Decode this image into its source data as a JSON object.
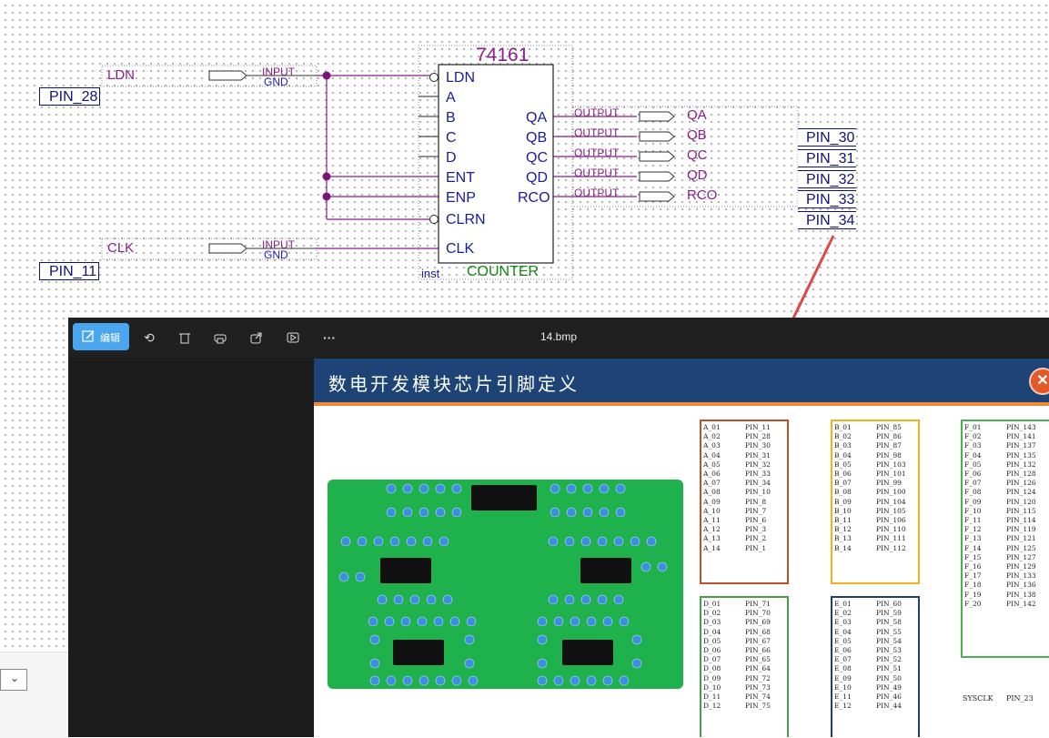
{
  "schematic": {
    "chip_name": "74161",
    "chip_type": "COUNTER",
    "inst_label": "inst",
    "inputs": [
      {
        "name": "LDN",
        "kind": "INPUT",
        "sub": "GND",
        "pin": "PIN_28"
      },
      {
        "name": "CLK",
        "kind": "INPUT",
        "sub": "GND",
        "pin": "PIN_11"
      }
    ],
    "chip_left_pins": [
      "LDN",
      "A",
      "B",
      "C",
      "D",
      "ENT",
      "ENP",
      "CLRN",
      "CLK"
    ],
    "chip_right_pins": [
      "QA",
      "QB",
      "QC",
      "QD",
      "RCO"
    ],
    "outputs": [
      {
        "kind": "OUTPUT",
        "name": "QA",
        "pin": "PIN_30"
      },
      {
        "kind": "OUTPUT",
        "name": "QB",
        "pin": "PIN_31"
      },
      {
        "kind": "OUTPUT",
        "name": "QC",
        "pin": "PIN_32"
      },
      {
        "kind": "OUTPUT",
        "name": "QD",
        "pin": "PIN_33"
      },
      {
        "kind": "OUTPUT",
        "name": "RCO",
        "pin": "PIN_34"
      }
    ],
    "arrow_color": "#e04848"
  },
  "viewer": {
    "edit_label": "编辑",
    "file_name": "14.bmp",
    "more_icon": "ellipsis-icon",
    "image": {
      "title": "数电开发模块芯片引脚定义",
      "board_color": "#1fb24c",
      "sysclk": {
        "name": "SYSCLK",
        "pin": "PIN_23"
      },
      "groups": [
        {
          "id": "A",
          "color": "#c0502a",
          "names": [
            "A_01",
            "A_02",
            "A_03",
            "A_04",
            "A_05",
            "A_06",
            "A_07",
            "A_08",
            "A_09",
            "A_10",
            "A_11",
            "A_12",
            "A_13",
            "A_14"
          ],
          "pins": [
            "PIN_11",
            "PIN_28",
            "PIN_30",
            "PIN_31",
            "PIN_32",
            "PIN_33",
            "PIN_34",
            "PIN_10",
            "PIN_8",
            "PIN_7",
            "PIN_6",
            "PIN_3",
            "PIN_2",
            "PIN_1"
          ]
        },
        {
          "id": "B",
          "color": "#f2b21e",
          "names": [
            "B_01",
            "B_02",
            "B_03",
            "B_04",
            "B_05",
            "B_06",
            "B_07",
            "B_08",
            "B_09",
            "B_10",
            "B_11",
            "B_12",
            "B_13",
            "B_14"
          ],
          "pins": [
            "PIN_85",
            "PIN_86",
            "PIN_87",
            "PIN_98",
            "PIN_103",
            "PIN_101",
            "PIN_99",
            "PIN_100",
            "PIN_104",
            "PIN_105",
            "PIN_106",
            "PIN_110",
            "PIN_111",
            "PIN_112"
          ]
        },
        {
          "id": "F",
          "color": "#4caf50",
          "names": [
            "F_01",
            "F_02",
            "F_03",
            "F_04",
            "F_05",
            "F_06",
            "F_07",
            "F_08",
            "F_09",
            "F_10",
            "F_11",
            "F_12",
            "F_13",
            "F_14",
            "F_15",
            "F_16",
            "F_17",
            "F_18",
            "F_19",
            "F_20"
          ],
          "pins": [
            "PIN_143",
            "PIN_141",
            "PIN_137",
            "PIN_135",
            "PIN_132",
            "PIN_128",
            "PIN_126",
            "PIN_124",
            "PIN_120",
            "PIN_115",
            "PIN_114",
            "PIN_119",
            "PIN_121",
            "PIN_125",
            "PIN_127",
            "PIN_129",
            "PIN_133",
            "PIN_136",
            "PIN_138",
            "PIN_142"
          ]
        },
        {
          "id": "D",
          "color": "#43a047",
          "names": [
            "D_01",
            "D_02",
            "D_03",
            "D_04",
            "D_05",
            "D_06",
            "D_07",
            "D_08",
            "D_09",
            "D_10",
            "D_11",
            "D_12"
          ],
          "pins": [
            "PIN_71",
            "PIN_70",
            "PIN_69",
            "PIN_68",
            "PIN_67",
            "PIN_66",
            "PIN_65",
            "PIN_64",
            "PIN_72",
            "PIN_73",
            "PIN_74",
            "PIN_75"
          ]
        },
        {
          "id": "E",
          "color": "#1d3f73",
          "names": [
            "E_01",
            "E_02",
            "E_03",
            "E_04",
            "E_05",
            "E_06",
            "E_07",
            "E_08",
            "E_09",
            "E_10",
            "E_11",
            "E_12"
          ],
          "pins": [
            "PIN_60",
            "PIN_59",
            "PIN_58",
            "PIN_55",
            "PIN_54",
            "PIN_53",
            "PIN_52",
            "PIN_51",
            "PIN_50",
            "PIN_49",
            "PIN_46",
            "PIN_44"
          ]
        }
      ]
    }
  }
}
